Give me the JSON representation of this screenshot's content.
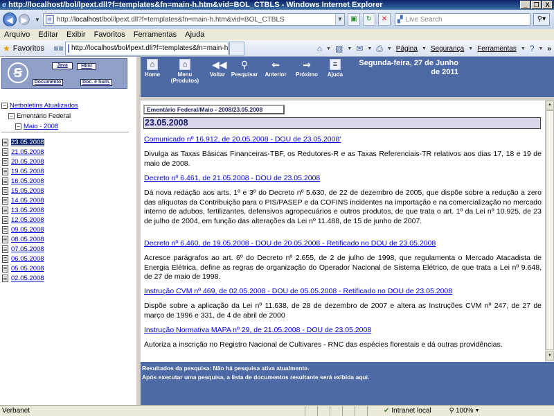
{
  "window": {
    "title": "http://localhost/bol/lpext.dll?f=templates&fn=main-h.htm&vid=BOL_CTBLS - Windows Internet Explorer",
    "controls": [
      "_",
      "❐",
      "X"
    ]
  },
  "address_bar": {
    "url_prefix": "http://",
    "url_host": "localhost",
    "url_rest": "/bol/lpext.dll?f=templates&fn=main-h.htm&vid=BOL_CTBLS",
    "search_placeholder": "Live Search"
  },
  "menu": [
    "Arquivo",
    "Editar",
    "Exibir",
    "Favoritos",
    "Ferramentas",
    "Ajuda"
  ],
  "favorites_bar": {
    "favorites_label": "Favoritos",
    "active_tab": "http://localhost/bol/lpext.dll?f=templates&fn=main-h....",
    "commands": [
      "Página",
      "Segurança",
      "Ferramentas"
    ]
  },
  "left_panel": {
    "logo_buttons": [
      "Java",
      "Html",
      "Documento",
      "Doc. e Sum."
    ],
    "tree": [
      {
        "label": "Netboletins Atualizados",
        "link": true
      },
      {
        "label": "Ementário Federal",
        "link": false
      },
      {
        "label": "Maio - 2008",
        "link": true
      }
    ],
    "dates": [
      "23.05.2008",
      "21.05.2008",
      "20.05.2008",
      "19.05.2008",
      "16.05.2008",
      "15.05.2008",
      "14.05.2008",
      "13.05.2008",
      "12.05.2008",
      "09.05.2008",
      "08.05.2008",
      "07.05.2008",
      "06.05.2008",
      "05.05.2008",
      "02.05.2008"
    ],
    "selected_date": "23.05.2008"
  },
  "toolbar": {
    "buttons": [
      "Home",
      "Menu (Produtos)",
      "Voltar",
      "Pesquisar",
      "Anterior",
      "Próximo",
      "Ajuda"
    ],
    "date_line1": "Segunda-feira, 27 de Junho",
    "date_line2": "de 2011"
  },
  "content": {
    "breadcrumb": "Ementário Federal/Maio - 2008/23.05.2008",
    "heading": "23.05.2008",
    "entries": [
      {
        "title": "Comunicado nº 16.912, de 20.05.2008 - DOU de 23.05.2008'",
        "description": "Divulga as Taxas Básicas Financeiras-TBF, os Redutores-R e as Taxas Referenciais-TR relativos aos dias 17, 18 e 19 de maio de 2008."
      },
      {
        "title": "Decreto nº 6.461, de 21.05.2008 - DOU de 23.05.2008",
        "description": "Dá nova redação aos arts. 1º e 3º do Decreto nº 5.630, de 22 de dezembro de 2005, que dispõe sobre a redução a zero das alíquotas da Contribuição para o PIS/PASEP e da COFINS incidentes na importação e na comercialização no mercado interno de adubos, fertilizantes, defensivos agropecuários e outros produtos, de que trata o art. 1º da Lei nº 10.925, de 23 de julho de 2004, em função das alterações da Lei nº 11.488, de 15 de junho de 2007."
      },
      {
        "title": "Decreto nº 6.460, de 19.05.2008 - DOU de 20.05.2008 - Retificado no DOU de 23.05.2008",
        "description": "Acresce parágrafos ao art. 6º do Decreto nº 2.655, de 2 de julho de 1998, que regulamenta o Mercado Atacadista de Energia Elétrica, define as regras de organização do Operador Nacional de Sistema Elétrico, de que trata a Lei nº 9.648, de 27 de maio de 1998."
      },
      {
        "title": "Instrução CVM nº 469, de 02.05.2008 - DOU de 05.05.2008 - Retificado no DOU de 23.05.2008",
        "description": "Dispõe sobre a aplicação da Lei nº 11.638, de 28 de dezembro de 2007 e altera as Instruções CVM nº 247, de 27 de março de 1996 e 331, de 4 de abril de 2000"
      },
      {
        "title": "Instrução Normativa MAPA nº 29, de 21.05.2008 - DOU de 23.05.2008",
        "description": "Autoriza a inscrição no Registro Nacional de Cultivares - RNC das espécies florestais e dá outras providências."
      }
    ]
  },
  "info_panel": {
    "line1": "Resultados da pesquisa: Não há pesquisa ativa atualmente.",
    "line2": "Após executar uma pesquisa, a lista de documentos resultante será exibida aqui."
  },
  "status_bar": {
    "text": "Verbanet",
    "zone": "Intranet local",
    "zoom": "100%"
  }
}
